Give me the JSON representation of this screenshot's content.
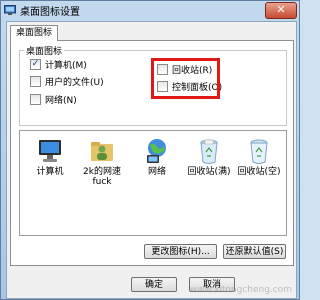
{
  "window": {
    "title": "桌面图标设置",
    "close_glyph": "✕"
  },
  "tabs": [
    {
      "label": "桌面图标"
    }
  ],
  "group": {
    "legend": "桌面图标",
    "checkboxes": [
      {
        "label": "计算机(M)",
        "checked": true
      },
      {
        "label": "用户的文件(U)",
        "checked": false
      },
      {
        "label": "网络(N)",
        "checked": false
      },
      {
        "label": "回收站(R)",
        "checked": false
      },
      {
        "label": "控制面板(O)",
        "checked": false
      }
    ],
    "check_glyph": "✓"
  },
  "icons": [
    {
      "label": "计算机",
      "icon": "computer-icon"
    },
    {
      "label": "2k的网速\nfuck",
      "icon": "user-folder-icon"
    },
    {
      "label": "网络",
      "icon": "network-icon"
    },
    {
      "label": "回收站(满)",
      "icon": "recycle-bin-full-icon"
    },
    {
      "label": "回收站(空)",
      "icon": "recycle-bin-empty-icon"
    }
  ],
  "buttons": {
    "change_icon": "更改图标(H)...",
    "restore_default": "还原默认值(S)",
    "ok": "确定",
    "cancel": "取消"
  },
  "watermark": "www.xitongcheng.com",
  "colors": {
    "highlight": "#e01818",
    "titlebar": "#c3d9ee",
    "close": "#c84a32"
  }
}
